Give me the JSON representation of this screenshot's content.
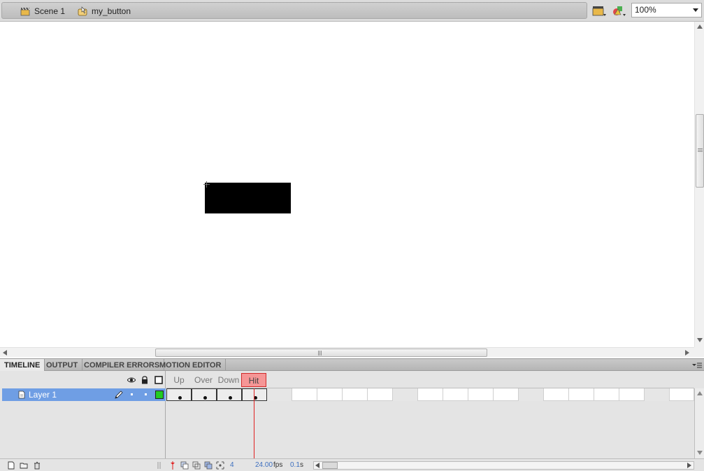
{
  "editbar": {
    "breadcrumbs": [
      {
        "label": "Scene 1",
        "icon": "scene-clapper-icon"
      },
      {
        "label": "my_button",
        "icon": "button-symbol-icon"
      }
    ],
    "zoom": "100%"
  },
  "panel_tabs": [
    "TIMELINE",
    "OUTPUT",
    "COMPILER ERRORS",
    "MOTION EDITOR"
  ],
  "timeline": {
    "frame_labels": [
      "Up",
      "Over",
      "Down",
      "Hit"
    ],
    "layers": [
      {
        "name": "Layer 1"
      }
    ],
    "current_frame": "4",
    "frame_rate": "24.00",
    "frame_rate_unit": "fps",
    "elapsed_time": "0.1",
    "elapsed_unit": "s"
  },
  "colors": {
    "layer_selected": "#6f9ee4",
    "hit_label": "#f59696",
    "playhead": "#e02020",
    "layer_outline": "#22cc22"
  }
}
